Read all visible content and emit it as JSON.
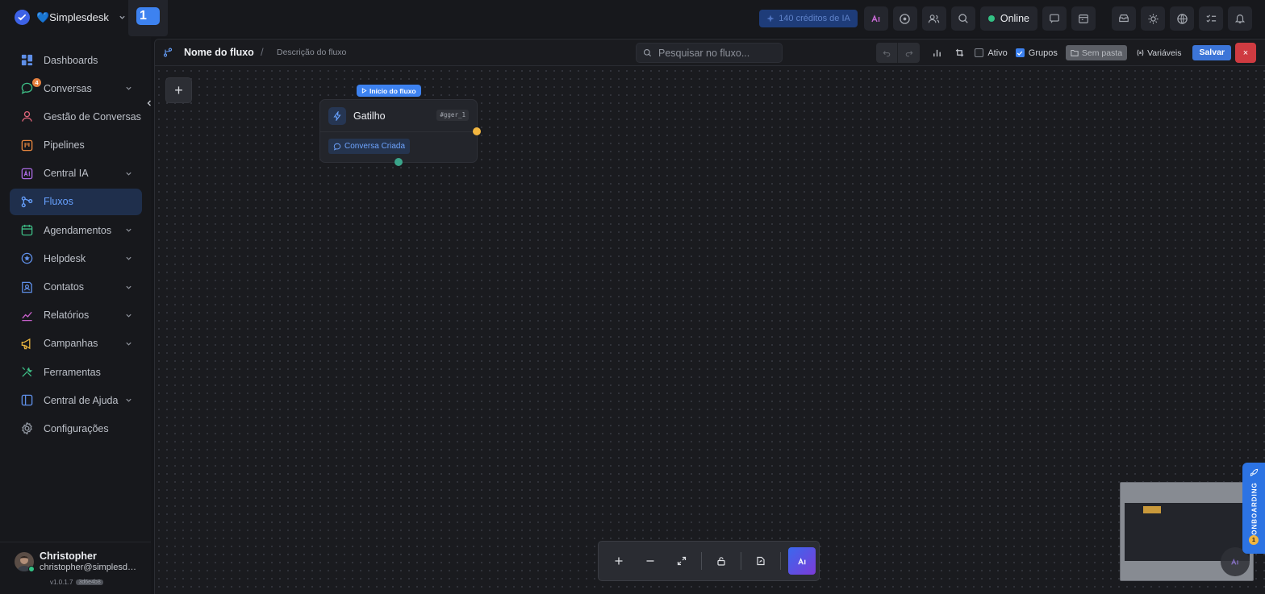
{
  "brand": {
    "name": "💙Simplesdesk",
    "workspace_badge": "1"
  },
  "topbar": {
    "ia_credits": "140 créditos de IA",
    "status": "Online"
  },
  "sidebar": {
    "items": [
      {
        "label": "Dashboards"
      },
      {
        "label": "Conversas",
        "count": "4"
      },
      {
        "label": "Gestão de Conversas"
      },
      {
        "label": "Pipelines"
      },
      {
        "label": "Central IA"
      },
      {
        "label": "Fluxos"
      },
      {
        "label": "Agendamentos"
      },
      {
        "label": "Helpdesk"
      },
      {
        "label": "Contatos"
      },
      {
        "label": "Relatórios"
      },
      {
        "label": "Campanhas"
      },
      {
        "label": "Ferramentas"
      },
      {
        "label": "Central de Ajuda"
      },
      {
        "label": "Configurações"
      }
    ],
    "user": {
      "name": "Christopher",
      "email": "christopher@simplesdesk.com.br",
      "version": "v1.0.1.7",
      "hash": "3d6e4b8"
    }
  },
  "editor": {
    "title": "Nome do fluxo",
    "separator": "/",
    "description": "Descrição do fluxo",
    "search_placeholder": "Pesquisar no fluxo...",
    "active_label": "Ativo",
    "groups_label": "Grupos",
    "folder_label": "Sem pasta",
    "variables_label": "Variáveis",
    "save_label": "Salvar",
    "close_label": "×"
  },
  "canvas": {
    "add_label": "+",
    "start_badge": "Início do fluxo",
    "node": {
      "title": "Gatilho",
      "id": "#gger_1",
      "tag": "Conversa Criada"
    }
  },
  "onboarding": {
    "label": "ONBOARDING",
    "count": "1"
  },
  "colors": {
    "accent": "#3d82f0",
    "danger": "#cf3b41",
    "online": "#33c184",
    "handle": "#f2b640"
  }
}
